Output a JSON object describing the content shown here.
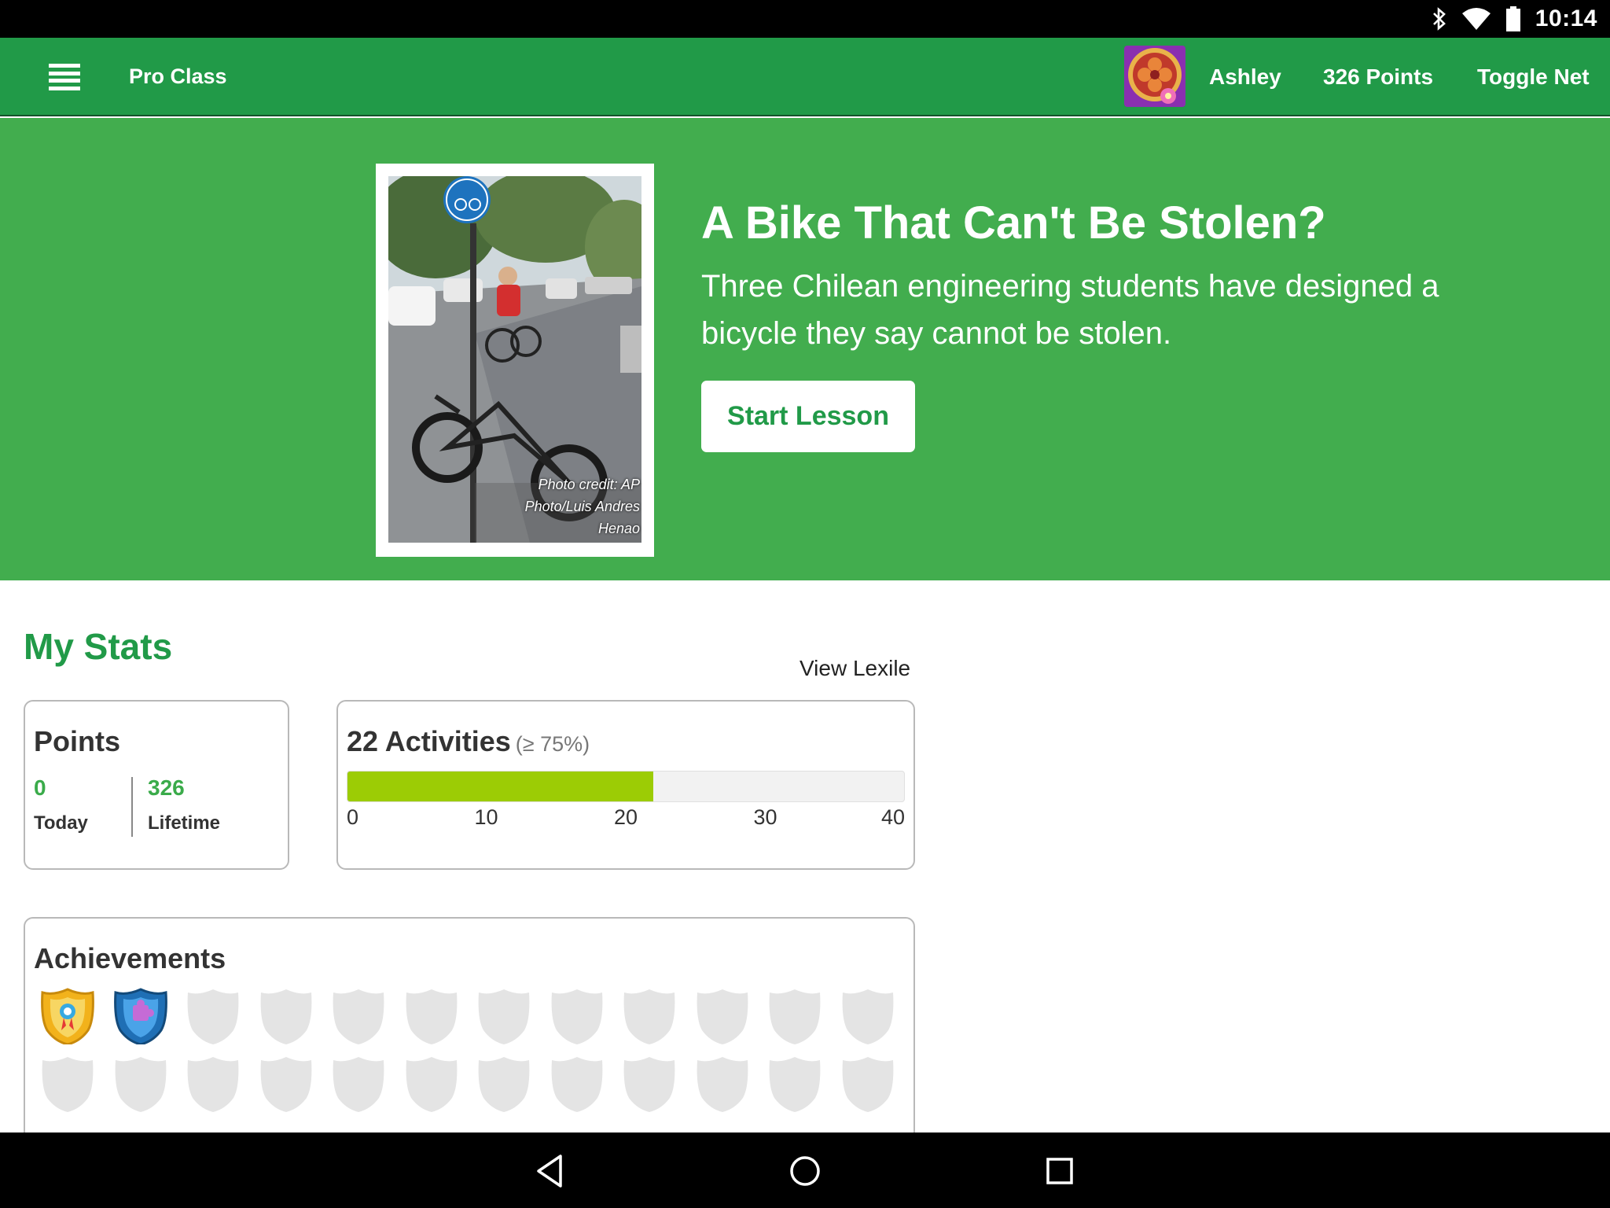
{
  "status_bar": {
    "time": "10:14",
    "icons": [
      "bluetooth-icon",
      "wifi-icon",
      "battery-icon"
    ]
  },
  "app_bar": {
    "menu_icon": "hamburger-menu-icon",
    "class_name": "Pro Class",
    "user_name": "Ashley",
    "points_total": "326 Points",
    "toggle_net": "Toggle Net"
  },
  "lesson": {
    "title": "A Bike That Can't Be Stolen?",
    "summary": "Three Chilean engineering students have designed a bicycle they say cannot be stolen.",
    "start_button": "Start Lesson",
    "photo_credit": "Photo credit: AP Photo/Luis Andres Henao"
  },
  "stats": {
    "title": "My Stats",
    "view_lexile": "View Lexile",
    "points": {
      "title": "Points",
      "today_value": "0",
      "today_label": "Today",
      "lifetime_value": "326",
      "lifetime_label": "Lifetime"
    },
    "activities": {
      "title": "22 Activities",
      "threshold": "(≥ 75%)",
      "progress_value": 22,
      "progress_max": 40,
      "ticks": [
        "0",
        "10",
        "20",
        "30",
        "40"
      ]
    },
    "achievements": {
      "title": "Achievements",
      "earned": [
        "gold-ribbon-shield",
        "blue-puzzle-shield"
      ],
      "locked_count": 22
    }
  },
  "colors": {
    "app_bar": "#219a48",
    "hero": "#42ad4e",
    "accent_text": "#219a48",
    "progress_fill": "#9ccc05",
    "locked_shield": "#e4e4e4"
  },
  "nav_bar": {
    "buttons": [
      "back-icon",
      "home-icon",
      "recents-icon"
    ]
  }
}
